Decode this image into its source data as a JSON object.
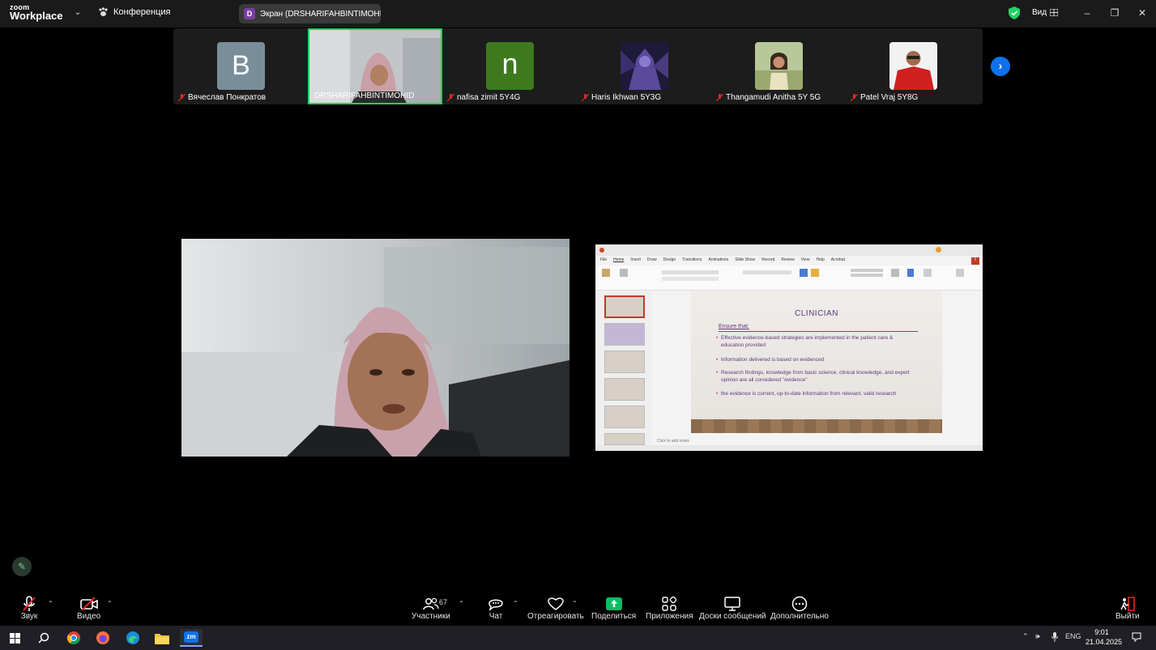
{
  "app": {
    "logo_top": "zoom",
    "logo_bottom": "Workplace",
    "meeting_label": "Конференция",
    "screen_share_label": "Экран (DRSHARIFAHBINTIMOHID",
    "screen_share_initial": "D",
    "view_label": "Вид"
  },
  "participants": [
    {
      "name": "Вячеслав Понкратов",
      "initial": "B",
      "avatar_color": "#7a8e9a",
      "muted": true
    },
    {
      "name": "DRSHARIFAHBINTIMOHID",
      "muted": false,
      "active": true
    },
    {
      "name": "nafisa zimit 5Y4G",
      "initial": "n",
      "avatar_color": "#3d7a1f",
      "muted": true
    },
    {
      "name": "Haris Ikhwan 5Y3G",
      "muted": true
    },
    {
      "name": "Thangamudi Anitha 5Y 5G",
      "muted": true
    },
    {
      "name": "Patel Vraj 5Y8G",
      "muted": true
    }
  ],
  "slide": {
    "title": "CLINICIAN",
    "ensure": "Ensure that:",
    "bullets": [
      "Effective evidence-based strategies are implemented in the patient care & education provided",
      "Information delivered is based on evidenced",
      "Research findings, knowledge from basic science, clinical knowledge, and expert opinion are all considered \"evidence\"",
      "the evidence is current, up-to-date information from relevant, valid research"
    ],
    "notes_placeholder": "Click to add notes",
    "menu": [
      "File",
      "Home",
      "Insert",
      "Draw",
      "Design",
      "Transitions",
      "Animations",
      "Slide Show",
      "Record",
      "Review",
      "View",
      "Help",
      "Acrobat"
    ]
  },
  "toolbar": {
    "audio": "Звук",
    "video": "Видео",
    "participants": "Участники",
    "participants_count": "67",
    "chat": "Чат",
    "react": "Отреагировать",
    "share": "Поделиться",
    "apps": "Приложения",
    "whiteboards": "Доски сообщений",
    "more": "Дополнительно",
    "leave": "Выйти"
  },
  "taskbar": {
    "lang": "ENG",
    "time": "9:01",
    "date": "21.04.2025",
    "zoom_icon_label": "zm"
  },
  "colors": {
    "accent_green": "#23d160",
    "share_green": "#0fbc63",
    "link_blue": "#0e72ed",
    "mute_red": "#e02828"
  }
}
